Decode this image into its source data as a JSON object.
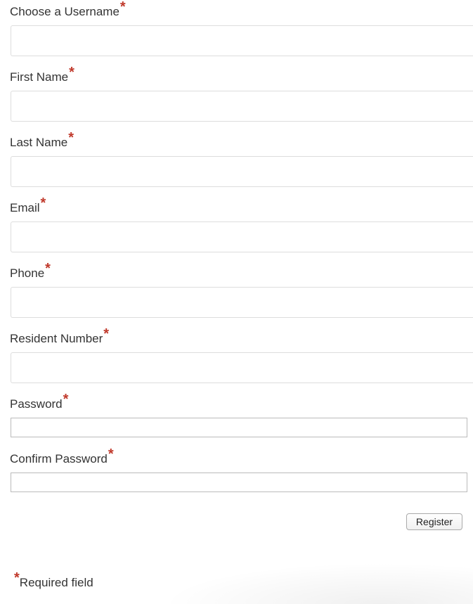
{
  "form": {
    "required_marker": "*",
    "fields": [
      {
        "label": "Choose a Username",
        "value": "",
        "placeholder": ""
      },
      {
        "label": "First Name",
        "value": "",
        "placeholder": ""
      },
      {
        "label": "Last Name",
        "value": "",
        "placeholder": ""
      },
      {
        "label": "Email",
        "value": "",
        "placeholder": ""
      },
      {
        "label": "Phone",
        "value": "",
        "placeholder": ""
      },
      {
        "label": "Resident Number",
        "value": "",
        "placeholder": ""
      },
      {
        "label": "Password",
        "value": "",
        "placeholder": ""
      },
      {
        "label": "Confirm Password",
        "value": "",
        "placeholder": ""
      }
    ],
    "register_label": "Register",
    "footnote_text": "Required field"
  },
  "colors": {
    "required_marker": "#c0392b",
    "label_text": "#333333",
    "input_border": "#dddddd"
  }
}
